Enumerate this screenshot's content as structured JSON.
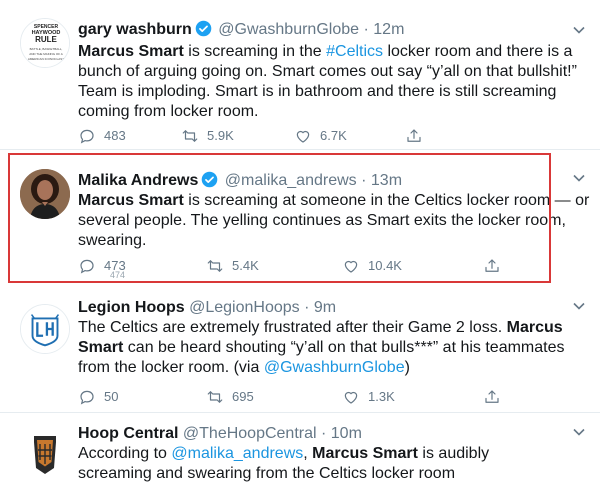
{
  "tweets": [
    {
      "name": "gary washburn",
      "handle": "@GwashburnGlobe",
      "sep": "·",
      "time": "12m",
      "avatar_text": [
        "SPENCER",
        "HAYWOOD",
        "RULE",
        "BATTLE, BASKETBALL,",
        "AND THE MAKING OF A",
        "AMERICAN ICONOCLAST"
      ],
      "text_parts": {
        "a": "Marcus Smart",
        "b": " is screaming in the ",
        "c": "#Celtics",
        "d": " locker room and there is a bunch of arguing going on. Smart comes out say “y’all on that bullshit!” Team is imploding. Smart is in bathroom and there is still screaming coming from locker room."
      },
      "reply": "483",
      "retweet": "5.9K",
      "like": "6.7K"
    },
    {
      "name": "Malika Andrews",
      "handle": "@malika_andrews",
      "sep": "·",
      "time": "13m",
      "text_parts": {
        "a": "Marcus Smart",
        "b": " is screaming at someone in the Celtics locker room — or several people. The yelling continues as Smart exits the locker room, swearing."
      },
      "reply": "473",
      "retweet": "5.4K",
      "like": "10.4K"
    },
    {
      "name": "Legion Hoops",
      "handle": "@LegionHoops",
      "sep": "·",
      "time": "9m",
      "text_parts": {
        "a": "The Celtics are extremely frustrated after their Game 2 loss. ",
        "b": "Marcus Smart",
        "c": " can be heard shouting “y’all on that bulls***” at his teammates from the locker room. (via ",
        "d": "@GwashburnGlobe",
        "e": ")"
      },
      "reply": "50",
      "retweet": "695",
      "like": "1.3K"
    },
    {
      "name": "Hoop Central",
      "handle": "@TheHoopCentral",
      "sep": "·",
      "time": "10m",
      "text_parts": {
        "a": "According to ",
        "b": "@malika_andrews",
        "c": ", ",
        "d": "Marcus Smart",
        "e": " is audibly screaming and swearing from the Celtics locker room"
      }
    }
  ],
  "ghost_text": "474",
  "colors": {
    "accent": "#1b95e0",
    "highlight": "#d93838",
    "muted": "#657786"
  },
  "icons": [
    "verified-badge-icon",
    "chevron-down-icon",
    "reply-icon",
    "retweet-icon",
    "like-icon",
    "share-icon"
  ]
}
